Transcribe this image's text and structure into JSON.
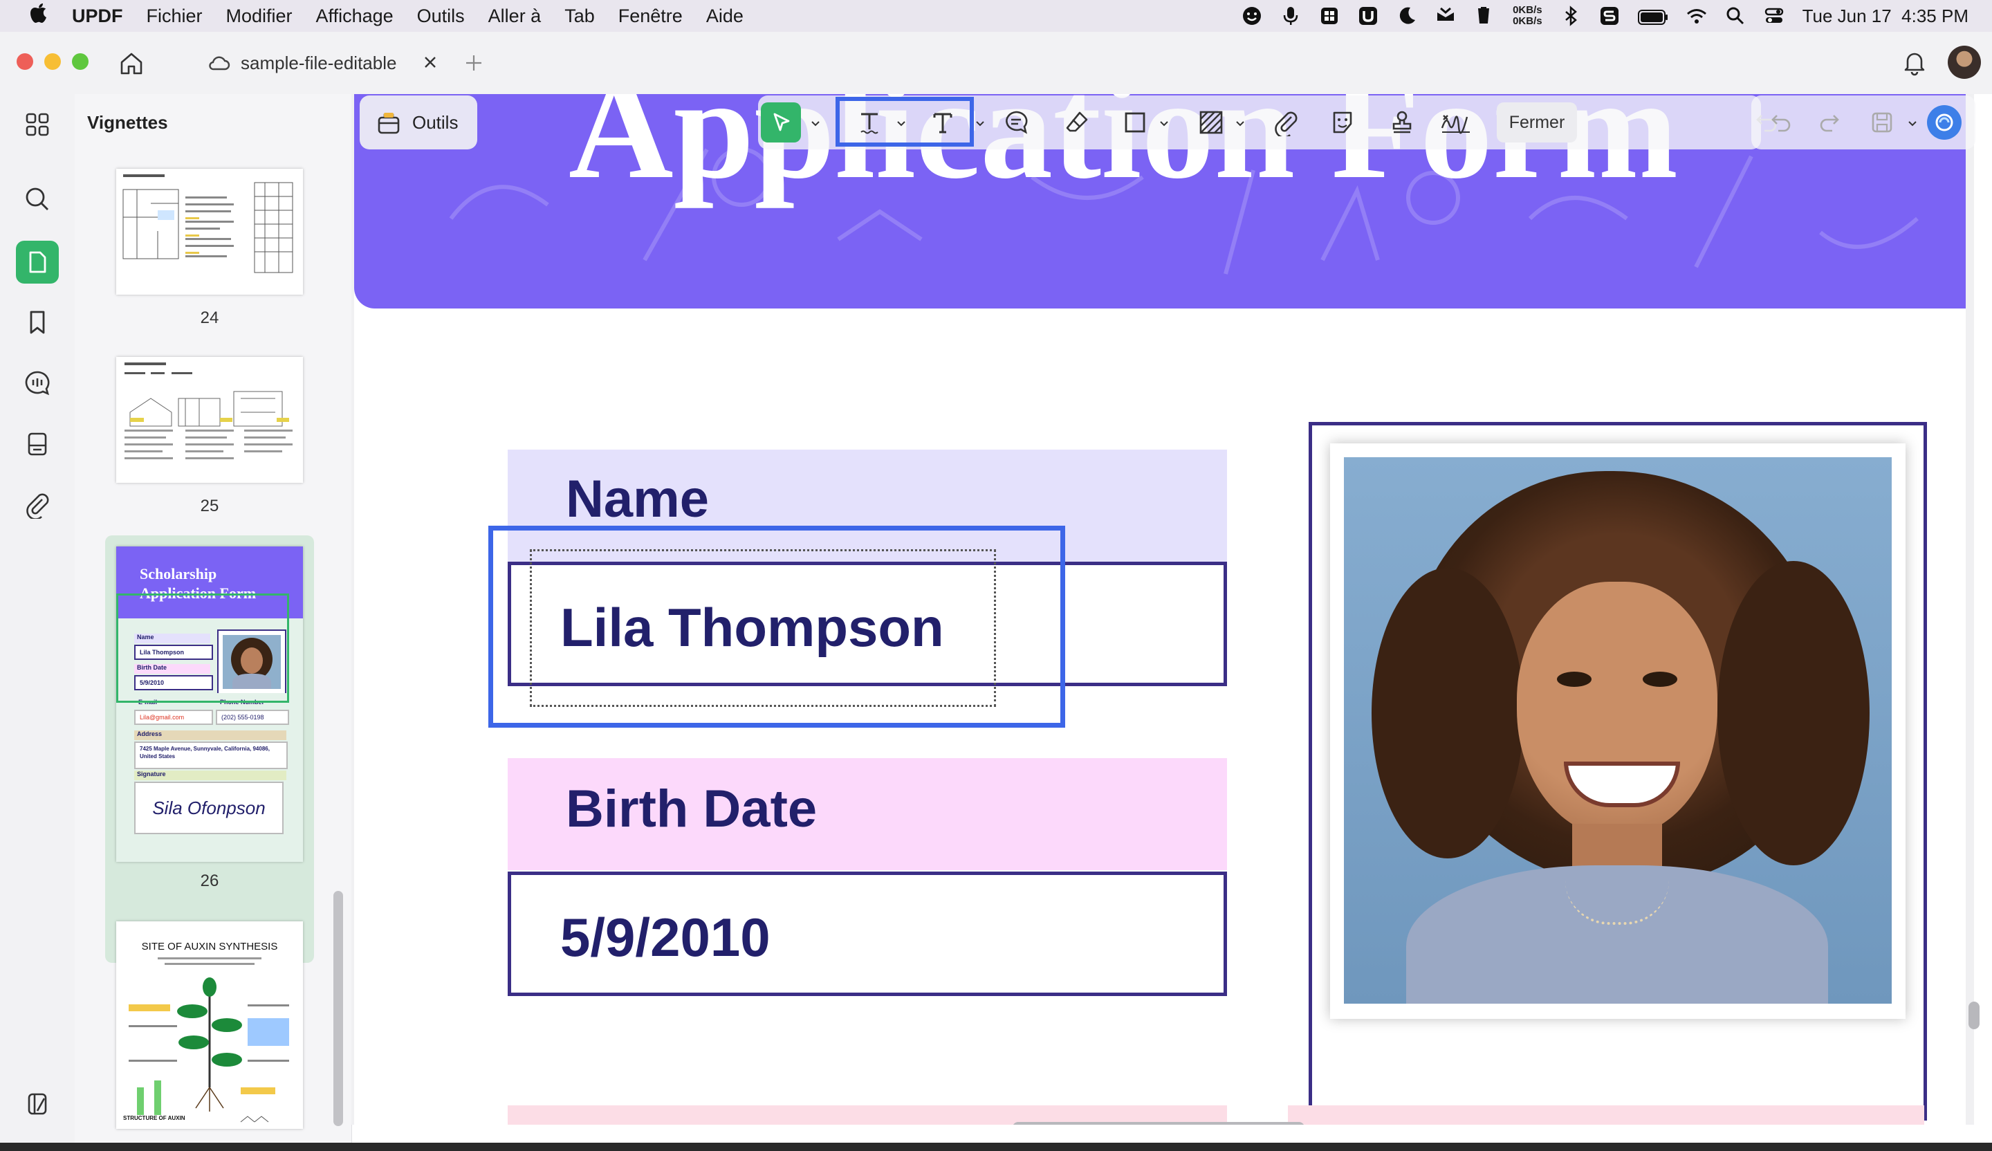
{
  "menubar": {
    "app_name": "UPDF",
    "items": [
      "Fichier",
      "Modifier",
      "Affichage",
      "Outils",
      "Aller à",
      "Tab",
      "Fenêtre",
      "Aide"
    ],
    "net_up": "0KB/s",
    "net_down": "0KB/s",
    "clock": "Tue Jun 17  4:35 PM"
  },
  "tab": {
    "title": "sample-file-editable"
  },
  "thumbnails": {
    "header": "Vignettes",
    "pages": [
      {
        "number": "24"
      },
      {
        "number": "25"
      },
      {
        "number": "26",
        "title_line1": "Scholarship",
        "title_line2": "Application Form",
        "name_label": "Name",
        "name_value": "Lila Thompson",
        "birth_label": "Birth Date",
        "birth_value": "5/9/2010",
        "email_label": "E-mail",
        "email_value": "Lila@gmail.com",
        "phone_label": "Phone Number",
        "phone_value": "(202) 555-0198",
        "address_label": "Address",
        "address_value": "7425 Maple Avenue, Sunnyvale, California, 94086, United States",
        "signature_label": "Signature",
        "signature_value": "Sila Ofonpson"
      },
      {
        "title": "SITE OF AUXIN SYNTHESIS",
        "footer_left": "STRUCTURE OF AUXIN"
      }
    ]
  },
  "toolbar": {
    "tools_label": "Outils",
    "close_label": "Fermer"
  },
  "document": {
    "title": "Application Form",
    "name_label": "Name",
    "name_value": "Lila Thompson",
    "birth_label": "Birth Date",
    "birth_value": "5/9/2010"
  },
  "colors": {
    "header_purple": "#7b63f4",
    "accent_blue": "#3d66e8",
    "label_navy": "#22206b",
    "name_band": "#e4e1fc",
    "birth_band": "#fcd9fb",
    "active_green": "#33b56a"
  }
}
